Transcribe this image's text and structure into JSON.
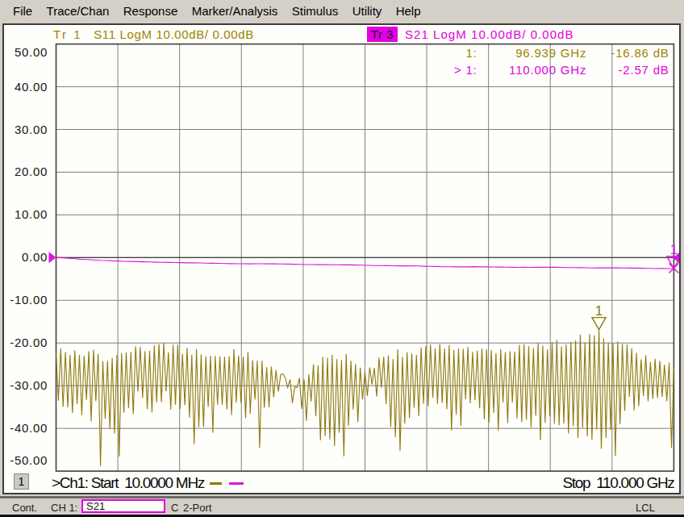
{
  "menu_bar": {
    "items": [
      {
        "label": "File"
      },
      {
        "label": "Trace/Chan"
      },
      {
        "label": "Response"
      },
      {
        "label": "Marker/Analysis"
      },
      {
        "label": "Stimulus"
      },
      {
        "label": "Utility"
      },
      {
        "label": "Help"
      }
    ]
  },
  "trace_titles": {
    "tr1": {
      "badge": "Tr 1",
      "text": "S11 LogM 10.00dB/ 0.00dB",
      "active": false
    },
    "tr3": {
      "badge": "Tr 3",
      "text": "S21 LogM 10.00dB/ 0.00dB",
      "active": true
    }
  },
  "marker_readout": {
    "rows": [
      {
        "label": "1:",
        "frequency": "96.939 GHz",
        "value": "-16.86 dB",
        "series": "S11"
      },
      {
        "label": "> 1:",
        "frequency": "110.000 GHz",
        "value": "-2.57 dB",
        "series": "S21"
      }
    ]
  },
  "stimulus_bar": {
    "channel_button": "1",
    "start_label": ">Ch1: Start  10.0000 MHz",
    "stop_label": "Stop  110.000 GHz"
  },
  "status_bar": {
    "sweep_mode": "Cont.",
    "channel_label": "CH 1:",
    "measurement": "S21",
    "correction": "C 2-Port",
    "remote_state": "LCL"
  },
  "colors": {
    "s11_trace": "#8f7a0e",
    "s11_text": "#9c8500",
    "s21_trace": "#e012e0",
    "s21_text": "#e400e4",
    "badge_bg": "#e000e0",
    "badge_text": "#26002a",
    "grid_line": "#7f7f7f",
    "grid_border": "#3f3f3f",
    "chrome_bg": "#d4d0c8",
    "screen_bg": "#fefefb"
  },
  "chart_data": {
    "type": "line",
    "x_axis": {
      "start_ghz": 0.01,
      "stop_ghz": 110.0,
      "start_label": ">Ch1: Start  10.0000 MHz",
      "stop_label": "Stop  110.000 GHz",
      "divisions": 10
    },
    "y_axis": {
      "min": -50,
      "max": 50,
      "step": 10,
      "tick_labels": [
        "50.00",
        "40.00",
        "30.00",
        "20.00",
        "10.00",
        "0.00",
        "-10.00",
        "-20.00",
        "-30.00",
        "-40.00",
        "-50.00"
      ]
    },
    "grid": true,
    "series": [
      {
        "name": "S11",
        "format": "LogM",
        "scale_per_div": "10.00dB/",
        "ref_level": "0.00dB",
        "color": "#8f7a0e",
        "values_db": [
          -22.4,
          -33.49,
          -21.3,
          -34.94,
          -22.13,
          -35.06,
          -22.77,
          -36.4,
          -21.71,
          -34.26,
          -22.81,
          -36.86,
          -23.0,
          -33.29,
          -21.95,
          -38.34,
          -21.58,
          -33.59,
          -22.57,
          -48.81,
          -24.25,
          -37.69,
          -24.14,
          -40.17,
          -23.5,
          -41.21,
          -22.78,
          -46.59,
          -22.43,
          -36.27,
          -22.24,
          -35.25,
          -22.12,
          -36.67,
          -20.76,
          -31.37,
          -20.93,
          -32.85,
          -21.91,
          -35.5,
          -21.8,
          -36.23,
          -20.57,
          -33.95,
          -20.22,
          -33.81,
          -19.97,
          -31.3,
          -22.23,
          -35.6,
          -20.39,
          -34.43,
          -20.39,
          -35.46,
          -22.54,
          -34.6,
          -21.13,
          -37.47,
          -22.76,
          -43.72,
          -21.4,
          -39.7,
          -22.65,
          -39.67,
          -23.17,
          -34.94,
          -23.01,
          -41.03,
          -23.01,
          -34.42,
          -23.17,
          -34.49,
          -23.24,
          -35.58,
          -23.05,
          -36.9,
          -21.41,
          -33.98,
          -22.91,
          -33.98,
          -23.22,
          -37.6,
          -22.1,
          -36.56,
          -24.07,
          -33.25,
          -24.12,
          -44.54,
          -24.17,
          -35.13,
          -25.67,
          -35.06,
          -25.52,
          -32.76,
          -26.35,
          -31.37,
          -27.4,
          -27.24,
          -28.2,
          -30.48,
          -28.52,
          -34.05,
          -30.22,
          -30.44,
          -28.18,
          -35.42,
          -28.52,
          -38.24,
          -27.39,
          -33.71,
          -24.98,
          -37.16,
          -25.22,
          -42.78,
          -23.27,
          -41.75,
          -23.43,
          -42.53,
          -22.76,
          -44.12,
          -23.78,
          -41.03,
          -24.02,
          -46.56,
          -22.59,
          -39.36,
          -24.14,
          -35.55,
          -24.93,
          -38.46,
          -25.75,
          -33.19,
          -26.66,
          -32.42,
          -25.74,
          -29.69,
          -25.85,
          -32.54,
          -23.46,
          -30.48,
          -23.25,
          -34.28,
          -22.91,
          -39.63,
          -23.78,
          -42.08,
          -21.51,
          -45.32,
          -23.28,
          -38.87,
          -22.15,
          -37.62,
          -22.39,
          -35.14,
          -22.77,
          -37.12,
          -21.02,
          -34.19,
          -20.73,
          -34.76,
          -20.32,
          -32.81,
          -21.29,
          -34.25,
          -20.17,
          -34.06,
          -21.32,
          -35.53,
          -20.45,
          -40.43,
          -21.65,
          -36.82,
          -21.3,
          -39.42,
          -21.38,
          -33.18,
          -20.95,
          -34.12,
          -22.12,
          -33.39,
          -21.79,
          -35.31,
          -21.32,
          -37.84,
          -21.48,
          -38.54,
          -21.69,
          -36.32,
          -22.4,
          -40.5,
          -21.44,
          -33.91,
          -22.13,
          -38.77,
          -21.93,
          -33.92,
          -22.05,
          -37.65,
          -20.41,
          -38.53,
          -20.34,
          -38.01,
          -20.74,
          -39.77,
          -21.16,
          -36.98,
          -20.0,
          -42.77,
          -20.63,
          -38.69,
          -21.52,
          -37.13,
          -19.78,
          -38.87,
          -19.3,
          -39.27,
          -20.78,
          -38.9,
          -20.32,
          -41.22,
          -19.79,
          -39.52,
          -19.39,
          -42.3,
          -18.08,
          -39.83,
          -19.84,
          -41.91,
          -17.85,
          -42.7,
          -18.2,
          -40.28,
          -16.86,
          -44.79,
          -18.96,
          -42.26,
          -19.95,
          -40.38,
          -20.01,
          -46.47,
          -19.69,
          -39.02,
          -20.22,
          -35.92,
          -20.37,
          -32.59,
          -21.21,
          -35.84,
          -22.25,
          -34.8,
          -23.85,
          -32.4,
          -22.89,
          -33.64,
          -24.42,
          -33.1,
          -23.73,
          -32.89,
          -24.16,
          -32.59,
          -25.11,
          -33.58,
          -24.57,
          -44.54,
          -25.73
        ]
      },
      {
        "name": "S21",
        "format": "LogM",
        "scale_per_div": "10.00dB/",
        "ref_level": "0.00dB",
        "color": "#e012e0",
        "values_db": [
          0.0,
          -0.051,
          -0.165,
          -0.277,
          -0.396,
          -0.464,
          -0.535,
          -0.644,
          -0.696,
          -0.76,
          -0.807,
          -0.878,
          -0.894,
          -0.948,
          -0.991,
          -1.032,
          -1.079,
          -1.123,
          -1.136,
          -1.169,
          -1.186,
          -1.212,
          -1.221,
          -1.257,
          -1.294,
          -1.326,
          -1.351,
          -1.383,
          -1.42,
          -1.448,
          -1.451,
          -1.455,
          -1.452,
          -1.444,
          -1.458,
          -1.451,
          -1.484,
          -1.529,
          -1.556,
          -1.584,
          -1.638,
          -1.638,
          -1.655,
          -1.661,
          -1.669,
          -1.684,
          -1.701,
          -1.716,
          -1.748,
          -1.786,
          -1.819,
          -1.862,
          -1.887,
          -1.907,
          -1.911,
          -1.93,
          -1.927,
          -1.941,
          -1.975,
          -2.025,
          -2.065,
          -2.093,
          -2.143,
          -2.155,
          -2.159,
          -2.162,
          -2.159,
          -2.147,
          -2.183,
          -2.168,
          -2.201,
          -2.226,
          -2.247,
          -2.282,
          -2.302,
          -2.276,
          -2.289,
          -2.281,
          -2.267,
          -2.277,
          -2.265,
          -2.286,
          -2.326,
          -2.36,
          -2.375,
          -2.385,
          -2.418,
          -2.407,
          -2.416,
          -2.416,
          -2.413,
          -2.441,
          -2.461,
          -2.466,
          -2.502,
          -2.543,
          -2.571,
          -2.566,
          -2.576,
          -2.57
        ]
      }
    ],
    "markers": [
      {
        "series": "S11",
        "number": "1",
        "freq_ghz": 96.939,
        "value_db": -16.86,
        "style": "triangle"
      },
      {
        "series": "S21",
        "number": "1",
        "freq_ghz": 110.0,
        "value_db": -2.57,
        "style": "triangle-x",
        "active": true
      }
    ],
    "reference_level_db": 0.0
  }
}
